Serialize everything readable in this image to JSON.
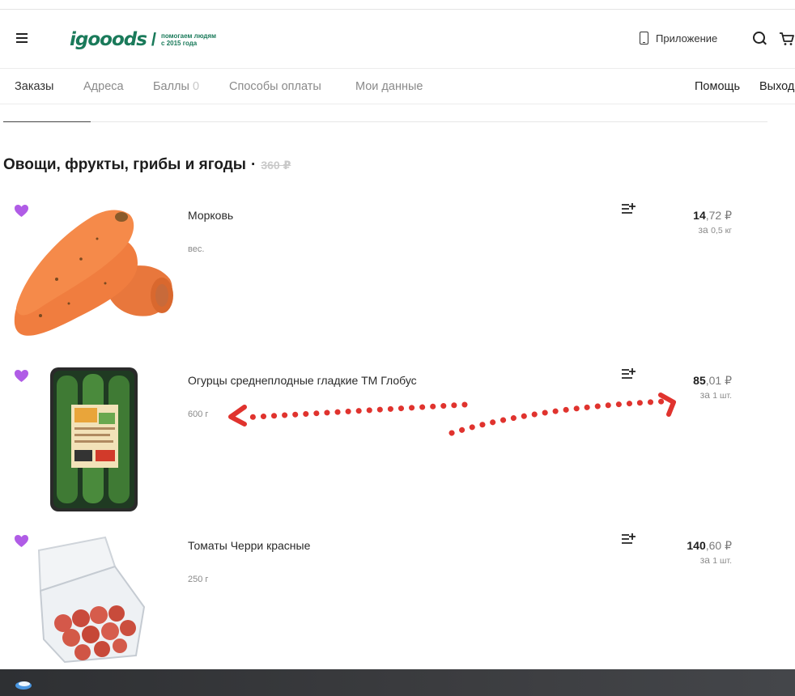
{
  "header": {
    "logo_text": "igooods",
    "logo_slash": "/",
    "tagline_line1": "помогаем людям",
    "tagline_line2": "с 2015 года",
    "app_link": "Приложение"
  },
  "nav": {
    "orders": "Заказы",
    "addresses": "Адреса",
    "points": "Баллы",
    "points_value": "0",
    "payment": "Способы оплаты",
    "my_data": "Мои данные",
    "help": "Помощь",
    "logout": "Выход"
  },
  "section": {
    "title": "Овощи, фрукты, грибы и ягоды",
    "separator": "·",
    "old_total": "360 ₽"
  },
  "products": [
    {
      "name": "Морковь",
      "weight": "вес.",
      "price_int": "14",
      "price_frac": ",72 ₽",
      "per_prefix": "за",
      "per_unit": "0,5 кг"
    },
    {
      "name": "Огурцы среднеплодные гладкие ТМ Глобус",
      "weight": "600 г",
      "price_int": "85",
      "price_frac": ",01 ₽",
      "per_prefix": "за",
      "per_unit": "1 шт."
    },
    {
      "name": "Томаты Черри красные",
      "weight": "250 г",
      "price_int": "140",
      "price_frac": ",60 ₽",
      "per_prefix": "за",
      "per_unit": "1 шт."
    }
  ],
  "icons": {
    "menu": "menu-icon",
    "phone": "phone-icon",
    "search": "search-icon",
    "cart": "cart-icon",
    "favorite": "heart-icon",
    "add_to_list": "list-add-icon",
    "start": "windows-start-icon"
  },
  "colors": {
    "brand": "#1a7a5a",
    "favorite": "#b05ce6",
    "annotation": "#e0332e"
  }
}
